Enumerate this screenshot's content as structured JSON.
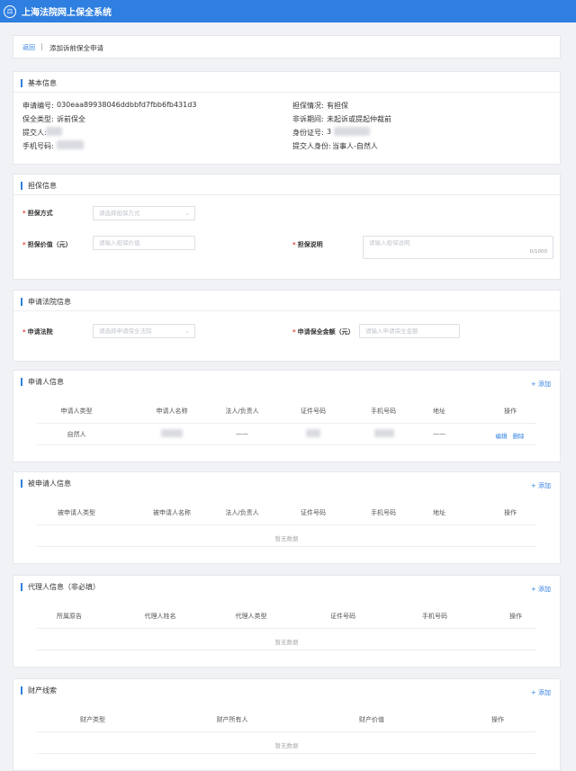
{
  "header": {
    "logo_icon": "court-emblem-icon",
    "title": "上海法院网上保全系统"
  },
  "breadcrumb": {
    "back": "返回",
    "sep": "|",
    "current": "添加诉前保全申请"
  },
  "basic": {
    "title": "基本信息",
    "app_no_label": "申请编号:",
    "app_no": "030eaa89938046ddbbfd7fbb6fb431d3",
    "type_label": "保全类型:",
    "type": "诉前保全",
    "submitter_label": "提交人:",
    "phone_label": "手机号码:",
    "guarantee_label": "担保情况:",
    "guarantee": "有担保",
    "period_label": "非诉期间:",
    "period": "未起诉或提起仲裁前",
    "id_label": "身份证号:",
    "id_prefix": "3",
    "identity_label": "提交人身份:",
    "identity": "当事人-自然人"
  },
  "guarantee": {
    "title": "担保信息",
    "method_label": "担保方式",
    "method_ph": "请选择担保方式",
    "value_label": "担保价值（元）",
    "value_ph": "请输入担保价值",
    "desc_label": "担保说明",
    "desc_ph": "请输入担保说明",
    "desc_count": "0/1000"
  },
  "court": {
    "title": "申请法院信息",
    "court_label": "申请法院",
    "court_ph": "请选择申请保全法院",
    "amount_label": "申请保全金额（元）",
    "amount_ph": "请输入申请保全金额"
  },
  "applicant": {
    "title": "申请人信息",
    "add": "+ 添加",
    "columns": [
      "申请人类型",
      "申请人名称",
      "法人/负责人",
      "证件号码",
      "手机号码",
      "地址",
      "操作"
    ],
    "row": {
      "type": "自然人",
      "legal": "——",
      "address": "——",
      "edit": "编辑",
      "delete": "删除"
    }
  },
  "respondent": {
    "title": "被申请人信息",
    "add": "+ 添加",
    "columns": [
      "被申请人类型",
      "被申请人名称",
      "法人/负责人",
      "证件号码",
      "手机号码",
      "地址",
      "操作"
    ],
    "empty": "暂无数据"
  },
  "agent": {
    "title": "代理人信息（非必填）",
    "add": "+ 添加",
    "columns": [
      "所属原告",
      "代理人姓名",
      "代理人类型",
      "证件号码",
      "手机号码",
      "操作"
    ],
    "empty": "暂无数据"
  },
  "property": {
    "title": "财产线索",
    "add": "+ 添加",
    "columns": [
      "财产类型",
      "财产所有人",
      "财产价值",
      "操作"
    ],
    "empty": "暂无数据"
  },
  "required_mark": "*",
  "colors": {
    "primary": "#2f7fe0",
    "required": "#e53935"
  }
}
